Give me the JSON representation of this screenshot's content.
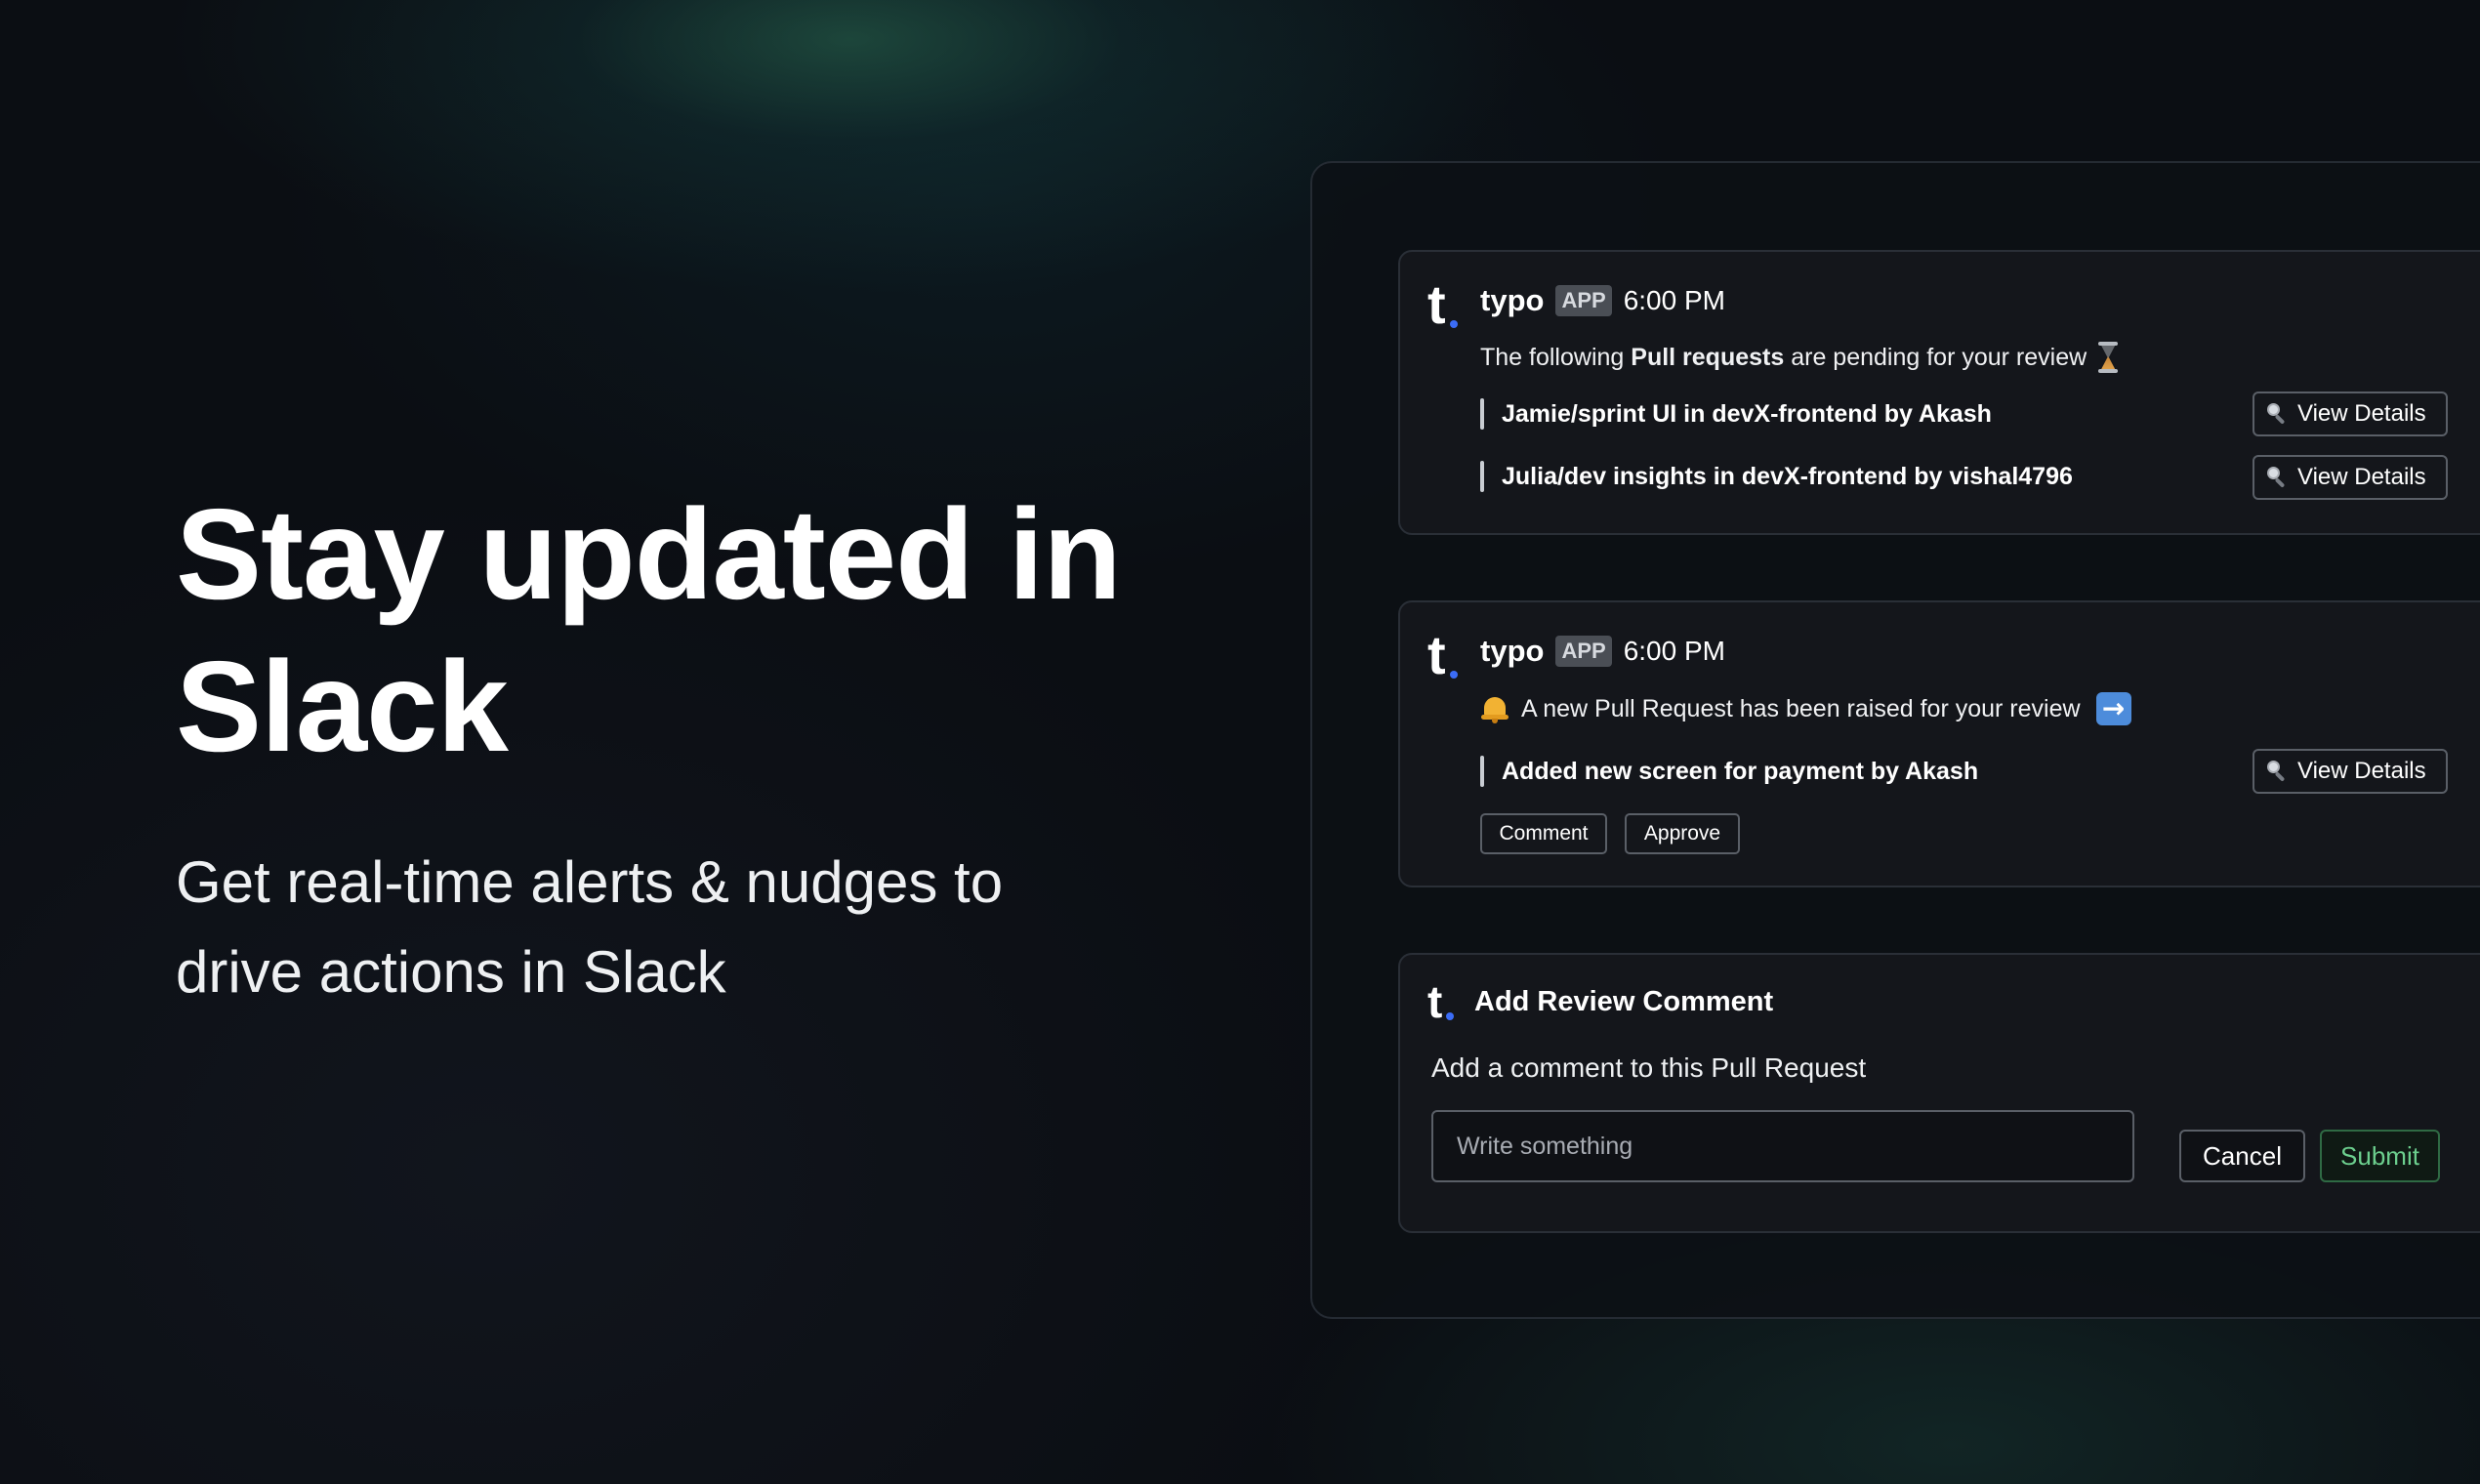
{
  "hero": {
    "title_line1": "Stay updated in",
    "title_line2": "Slack",
    "subtitle_line1": "Get real-time alerts & nudges to",
    "subtitle_line2": "drive actions in Slack"
  },
  "messages": [
    {
      "app_name": "typo",
      "badge": "APP",
      "time": "6:00 PM",
      "text_prefix": "The following",
      "text_bold": "Pull requests",
      "text_suffix": "are pending for your review",
      "text_icon": "hourglass-icon",
      "pull_requests": [
        {
          "title": "Jamie/sprint UI in devX-frontend by Akash",
          "action_label": "View Details",
          "action_icon": "magnifying-glass-icon"
        },
        {
          "title": "Julia/dev insights in devX-frontend by vishal4796",
          "action_label": "View Details",
          "action_icon": "magnifying-glass-icon"
        }
      ]
    },
    {
      "app_name": "typo",
      "badge": "APP",
      "time": "6:00 PM",
      "text": "A new Pull Request has been raised for your review",
      "text_leading_icon": "bell-icon",
      "text_trailing_icon": "right-arrow-icon",
      "pull_requests": [
        {
          "title": "Added new screen for payment by Akash",
          "action_label": "View Details",
          "action_icon": "magnifying-glass-icon"
        }
      ],
      "buttons": {
        "comment": "Comment",
        "approve": "Approve"
      }
    }
  ],
  "review_dialog": {
    "title": "Add Review Comment",
    "description": "Add a comment to this Pull Request",
    "input_placeholder": "Write something",
    "input_value": "",
    "cancel_label": "Cancel",
    "submit_label": "Submit"
  },
  "logo": {
    "letter": "t",
    "accent_color": "#3b6cf6"
  },
  "colors": {
    "background": "#0b0e13",
    "card": "#14161b",
    "submit_accent": "#6ccf8e"
  }
}
